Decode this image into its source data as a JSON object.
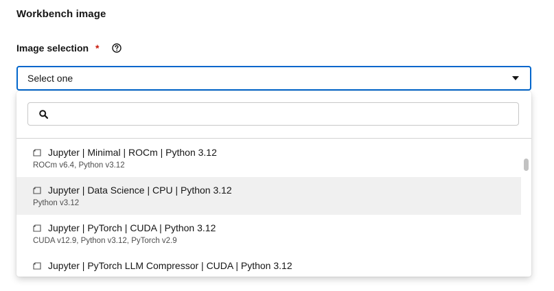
{
  "section": {
    "title": "Workbench image"
  },
  "field": {
    "label": "Image selection",
    "required_mark": "*"
  },
  "select": {
    "value": "Select one"
  },
  "search": {
    "placeholder": ""
  },
  "options": [
    {
      "title": "Jupyter | Minimal | ROCm | Python 3.12",
      "description": "ROCm v6.4, Python v3.12"
    },
    {
      "title": "Jupyter | Data Science | CPU | Python 3.12",
      "description": "Python v3.12"
    },
    {
      "title": "Jupyter | PyTorch | CUDA | Python 3.12",
      "description": "CUDA v12.9, Python v3.12, PyTorch v2.9"
    },
    {
      "title": "Jupyter | PyTorch LLM Compressor | CUDA | Python 3.12",
      "description": ""
    }
  ],
  "icons": {
    "help": "help-circle-icon",
    "caret": "caret-down-icon",
    "search": "search-icon",
    "option": "image-tag-icon"
  },
  "colors": {
    "accent": "#0066cc",
    "required": "#c9190b",
    "hover_row": "#f0f0f0"
  }
}
